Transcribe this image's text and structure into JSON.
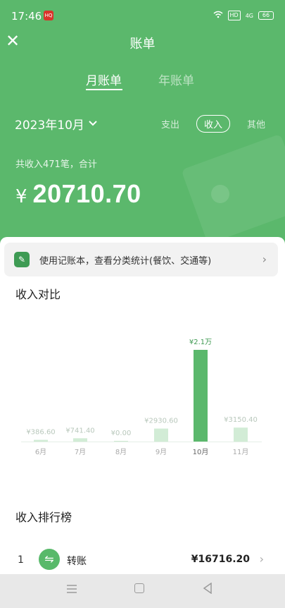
{
  "status_bar": {
    "time": "17:46",
    "app_badge": "HQ",
    "hd_label": "HD",
    "network": "4G",
    "battery": "66"
  },
  "header": {
    "title": "账单",
    "close_icon": "close-icon"
  },
  "tabs": {
    "month": "月账单",
    "year": "年账单"
  },
  "filter": {
    "date": "2023年10月",
    "types": {
      "expense": "支出",
      "income": "收入",
      "other": "其他"
    },
    "selected": "收入"
  },
  "summary": {
    "label": "共收入471笔，合计",
    "currency": "¥",
    "amount": "20710.70"
  },
  "promo": {
    "text": "使用记账本，查看分类统计(餐饮、交通等)"
  },
  "comparison": {
    "title": "收入对比"
  },
  "chart_data": {
    "type": "bar",
    "categories": [
      "6月",
      "7月",
      "8月",
      "9月",
      "10月",
      "11月"
    ],
    "values": [
      386.6,
      741.4,
      0.0,
      2930.6,
      20710.7,
      3150.4
    ],
    "labels": [
      "¥386.60",
      "¥741.40",
      "¥0.00",
      "¥2930.60",
      "¥2.1万",
      "¥3150.40"
    ],
    "highlight_index": 4,
    "colors": {
      "highlight": "#5bb86c",
      "normal": "#d2ecd6",
      "label": "#b9c8bc",
      "label_highlight": "#3f9a52"
    }
  },
  "ranking": {
    "title": "收入排行榜",
    "items": [
      {
        "rank": "1",
        "name": "转账",
        "amount": "¥16716.20",
        "icon": "transfer-icon"
      }
    ]
  },
  "colors": {
    "primary": "#5bb86c"
  }
}
